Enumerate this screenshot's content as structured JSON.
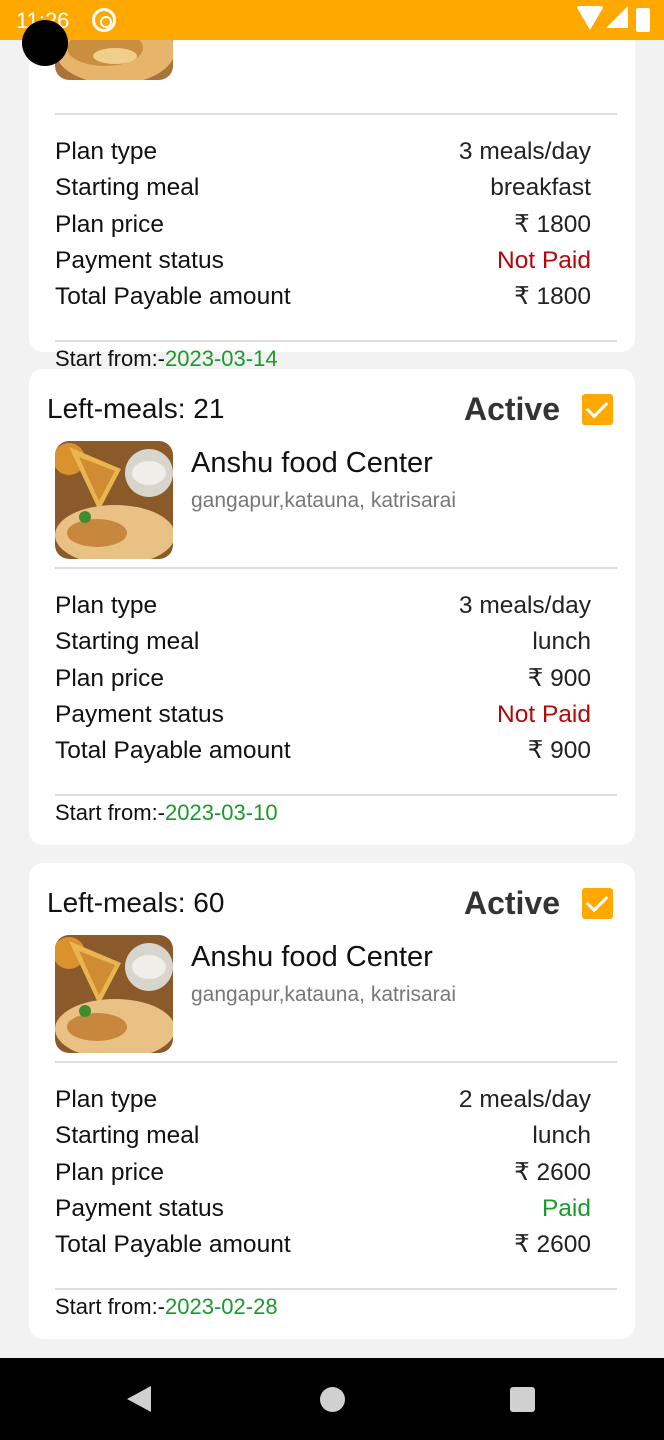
{
  "status_bar": {
    "time": "11:26",
    "accent_color": "#ffa800"
  },
  "labels": {
    "plan_type": "Plan type",
    "starting_meal": "Starting meal",
    "plan_price": "Plan price",
    "payment_status": "Payment status",
    "total_payable": "Total Payable amount",
    "start_from": "Start from:-"
  },
  "subscriptions": [
    {
      "plan_type": "3 meals/day",
      "starting_meal": "breakfast",
      "plan_price": "₹ 1800",
      "payment_status": "Not Paid",
      "total_payable": "₹ 1800",
      "start_date": "2023-03-14"
    },
    {
      "left_meals": "Left-meals: 21",
      "status": "Active",
      "checked": true,
      "restaurant_name": "Anshu food Center",
      "restaurant_address": "gangapur,katauna, katrisarai",
      "plan_type": "3 meals/day",
      "starting_meal": "lunch",
      "plan_price": "₹ 900",
      "payment_status": "Not Paid",
      "total_payable": "₹ 900",
      "start_date": "2023-03-10"
    },
    {
      "left_meals": "Left-meals: 60",
      "status": "Active",
      "checked": true,
      "restaurant_name": "Anshu food Center",
      "restaurant_address": "gangapur,katauna, katrisarai",
      "plan_type": "2 meals/day",
      "starting_meal": "lunch",
      "plan_price": "₹ 2600",
      "payment_status": "Paid",
      "total_payable": "₹ 2600",
      "start_date": "2023-02-28"
    }
  ],
  "colors": {
    "not_paid": "#b3070b",
    "paid": "#1a9a2c",
    "start_date": "#1a9a2c"
  }
}
